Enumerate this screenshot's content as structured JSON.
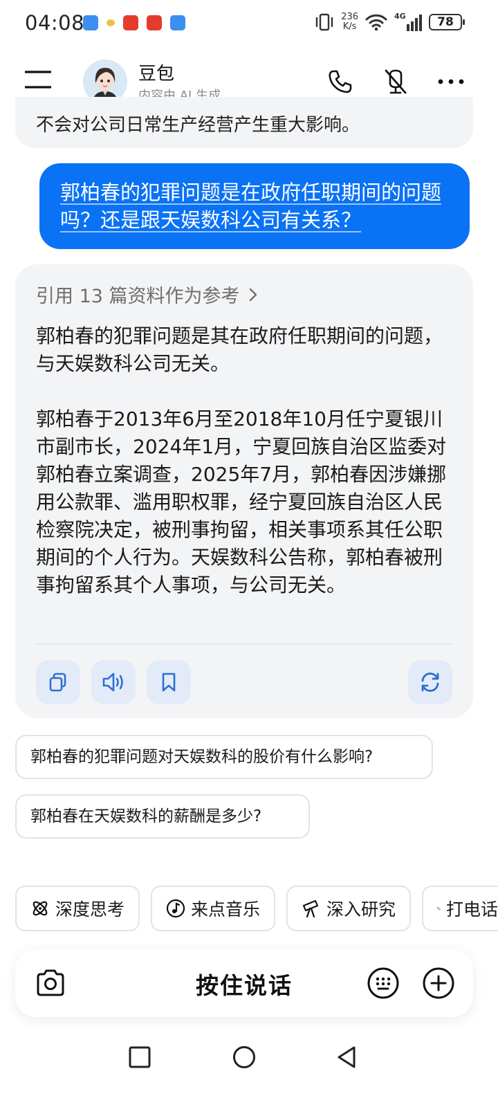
{
  "status_bar": {
    "time": "04:08",
    "net_speed_value": "236",
    "net_speed_unit": "K/s",
    "network": "4G",
    "battery": "78",
    "notif_colors": [
      "#3a8ff0",
      "#f0c040",
      "#e53b2c",
      "#e53b2c",
      "#3a8ff0"
    ]
  },
  "header": {
    "bot_name": "豆包",
    "subtitle": "内容由 AI 生成"
  },
  "chat": {
    "previous_text_fragment": "不会对公司日常生产经营产生重大影响。",
    "user_message": "郭柏春的犯罪问题是在政府任职期间的问题吗？还是跟天娱数科公司有关系？",
    "ai_reference": "引用 13 篇资料作为参考",
    "ai_paragraphs": [
      "郭柏春的犯罪问题是其在政府任职期间的问题，与天娱数科公司无关。",
      "郭柏春于2013年6月至2018年10月任宁夏银川市副市长，2024年1月，宁夏回族自治区监委对郭柏春立案调查，2025年7月，郭柏春因涉嫌挪用公款罪、滥用职权罪，经宁夏回族自治区人民检察院决定，被刑事拘留，相关事项系其任公职期间的个人行为。天娱数科公告称，郭柏春被刑事拘留系其个人事项，与公司无关。"
    ]
  },
  "suggestions": [
    "郭柏春的犯罪问题对天娱数科的股价有什么影响?",
    "郭柏春在天娱数科的薪酬是多少?"
  ],
  "tools": [
    {
      "label": "深度思考",
      "icon": "atom-icon"
    },
    {
      "label": "来点音乐",
      "icon": "music-note-icon"
    },
    {
      "label": "深入研究",
      "icon": "telescope-icon"
    },
    {
      "label": "打电话",
      "icon": "phone-icon"
    }
  ],
  "input_bar": {
    "hold_to_talk": "按住说话"
  },
  "colors": {
    "accent": "#0a72f5",
    "card_bg": "#f3f4f6",
    "action_btn_bg": "#e3ebf8",
    "action_icon": "#2f6fd0"
  }
}
